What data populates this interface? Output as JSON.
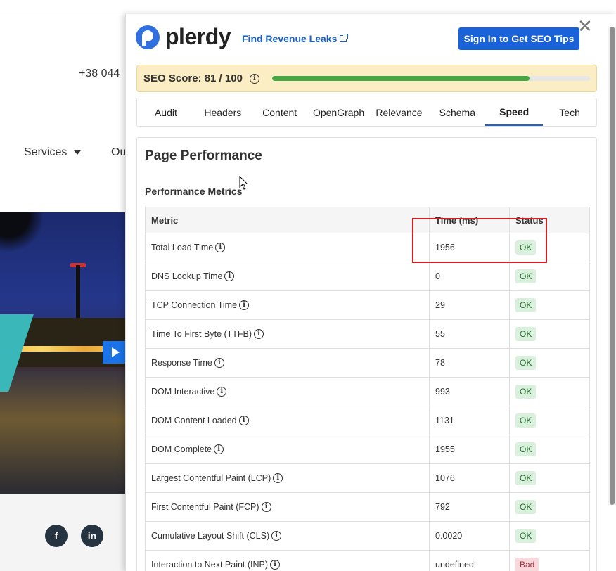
{
  "background": {
    "phone": "+38 044",
    "nav_services": "Services",
    "nav_ou": "Ou",
    "social": [
      {
        "name": "facebook-icon",
        "glyph": "f"
      },
      {
        "name": "linkedin-icon",
        "glyph": "in"
      }
    ]
  },
  "plerdy": {
    "logo_text": "plerdy",
    "revenue_link": "Find Revenue Leaks",
    "signin": "Sign In to Get SEO Tips",
    "close": "✕",
    "seo_score_label": "SEO Score: 81 / 100",
    "seo_score_value": 81,
    "seo_score_max": 100,
    "tabs": [
      {
        "label": "Audit"
      },
      {
        "label": "Headers"
      },
      {
        "label": "Content"
      },
      {
        "label": "OpenGraph"
      },
      {
        "label": "Relevance"
      },
      {
        "label": "Schema"
      },
      {
        "label": "Speed",
        "active": true
      },
      {
        "label": "Tech"
      }
    ],
    "page_title": "Page Performance",
    "section_title": "Performance Metrics",
    "table": {
      "headers": [
        "Metric",
        "Time (ms)",
        "Status"
      ],
      "rows": [
        {
          "metric": "Total Load Time",
          "time": "1956",
          "status": "OK"
        },
        {
          "metric": "DNS Lookup Time",
          "time": "0",
          "status": "OK"
        },
        {
          "metric": "TCP Connection Time",
          "time": "29",
          "status": "OK"
        },
        {
          "metric": "Time To First Byte (TTFB)",
          "time": "55",
          "status": "OK"
        },
        {
          "metric": "Response Time",
          "time": "78",
          "status": "OK"
        },
        {
          "metric": "DOM Interactive",
          "time": "993",
          "status": "OK"
        },
        {
          "metric": "DOM Content Loaded",
          "time": "1131",
          "status": "OK"
        },
        {
          "metric": "DOM Complete",
          "time": "1955",
          "status": "OK"
        },
        {
          "metric": "Largest Contentful Paint (LCP)",
          "time": "1076",
          "status": "OK"
        },
        {
          "metric": "First Contentful Paint (FCP)",
          "time": "792",
          "status": "OK"
        },
        {
          "metric": "Cumulative Layout Shift (CLS)",
          "time": "0.0020",
          "status": "OK"
        },
        {
          "metric": "Interaction to Next Paint (INP)",
          "time": "undefined",
          "status": "Bad"
        }
      ]
    },
    "colors": {
      "accent": "#1a62d8",
      "score_fill": "#45a845",
      "ok_bg": "#d8f0dc",
      "bad_bg": "#f9d8dc",
      "highlight": "#d42020"
    }
  }
}
